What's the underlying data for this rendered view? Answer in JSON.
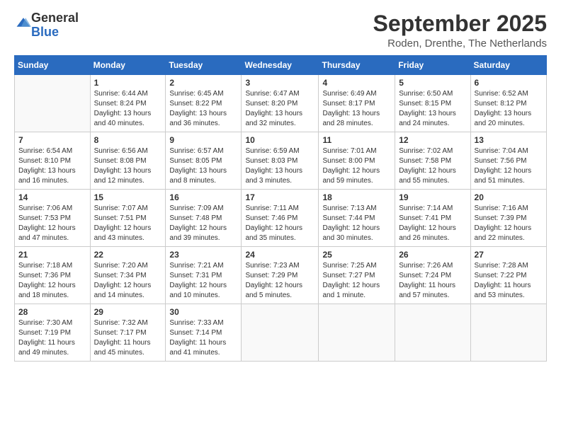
{
  "header": {
    "logo_general": "General",
    "logo_blue": "Blue",
    "month_title": "September 2025",
    "location": "Roden, Drenthe, The Netherlands"
  },
  "days_of_week": [
    "Sunday",
    "Monday",
    "Tuesday",
    "Wednesday",
    "Thursday",
    "Friday",
    "Saturday"
  ],
  "weeks": [
    [
      {
        "num": "",
        "info": ""
      },
      {
        "num": "1",
        "info": "Sunrise: 6:44 AM\nSunset: 8:24 PM\nDaylight: 13 hours\nand 40 minutes."
      },
      {
        "num": "2",
        "info": "Sunrise: 6:45 AM\nSunset: 8:22 PM\nDaylight: 13 hours\nand 36 minutes."
      },
      {
        "num": "3",
        "info": "Sunrise: 6:47 AM\nSunset: 8:20 PM\nDaylight: 13 hours\nand 32 minutes."
      },
      {
        "num": "4",
        "info": "Sunrise: 6:49 AM\nSunset: 8:17 PM\nDaylight: 13 hours\nand 28 minutes."
      },
      {
        "num": "5",
        "info": "Sunrise: 6:50 AM\nSunset: 8:15 PM\nDaylight: 13 hours\nand 24 minutes."
      },
      {
        "num": "6",
        "info": "Sunrise: 6:52 AM\nSunset: 8:12 PM\nDaylight: 13 hours\nand 20 minutes."
      }
    ],
    [
      {
        "num": "7",
        "info": "Sunrise: 6:54 AM\nSunset: 8:10 PM\nDaylight: 13 hours\nand 16 minutes."
      },
      {
        "num": "8",
        "info": "Sunrise: 6:56 AM\nSunset: 8:08 PM\nDaylight: 13 hours\nand 12 minutes."
      },
      {
        "num": "9",
        "info": "Sunrise: 6:57 AM\nSunset: 8:05 PM\nDaylight: 13 hours\nand 8 minutes."
      },
      {
        "num": "10",
        "info": "Sunrise: 6:59 AM\nSunset: 8:03 PM\nDaylight: 13 hours\nand 3 minutes."
      },
      {
        "num": "11",
        "info": "Sunrise: 7:01 AM\nSunset: 8:00 PM\nDaylight: 12 hours\nand 59 minutes."
      },
      {
        "num": "12",
        "info": "Sunrise: 7:02 AM\nSunset: 7:58 PM\nDaylight: 12 hours\nand 55 minutes."
      },
      {
        "num": "13",
        "info": "Sunrise: 7:04 AM\nSunset: 7:56 PM\nDaylight: 12 hours\nand 51 minutes."
      }
    ],
    [
      {
        "num": "14",
        "info": "Sunrise: 7:06 AM\nSunset: 7:53 PM\nDaylight: 12 hours\nand 47 minutes."
      },
      {
        "num": "15",
        "info": "Sunrise: 7:07 AM\nSunset: 7:51 PM\nDaylight: 12 hours\nand 43 minutes."
      },
      {
        "num": "16",
        "info": "Sunrise: 7:09 AM\nSunset: 7:48 PM\nDaylight: 12 hours\nand 39 minutes."
      },
      {
        "num": "17",
        "info": "Sunrise: 7:11 AM\nSunset: 7:46 PM\nDaylight: 12 hours\nand 35 minutes."
      },
      {
        "num": "18",
        "info": "Sunrise: 7:13 AM\nSunset: 7:44 PM\nDaylight: 12 hours\nand 30 minutes."
      },
      {
        "num": "19",
        "info": "Sunrise: 7:14 AM\nSunset: 7:41 PM\nDaylight: 12 hours\nand 26 minutes."
      },
      {
        "num": "20",
        "info": "Sunrise: 7:16 AM\nSunset: 7:39 PM\nDaylight: 12 hours\nand 22 minutes."
      }
    ],
    [
      {
        "num": "21",
        "info": "Sunrise: 7:18 AM\nSunset: 7:36 PM\nDaylight: 12 hours\nand 18 minutes."
      },
      {
        "num": "22",
        "info": "Sunrise: 7:20 AM\nSunset: 7:34 PM\nDaylight: 12 hours\nand 14 minutes."
      },
      {
        "num": "23",
        "info": "Sunrise: 7:21 AM\nSunset: 7:31 PM\nDaylight: 12 hours\nand 10 minutes."
      },
      {
        "num": "24",
        "info": "Sunrise: 7:23 AM\nSunset: 7:29 PM\nDaylight: 12 hours\nand 5 minutes."
      },
      {
        "num": "25",
        "info": "Sunrise: 7:25 AM\nSunset: 7:27 PM\nDaylight: 12 hours\nand 1 minute."
      },
      {
        "num": "26",
        "info": "Sunrise: 7:26 AM\nSunset: 7:24 PM\nDaylight: 11 hours\nand 57 minutes."
      },
      {
        "num": "27",
        "info": "Sunrise: 7:28 AM\nSunset: 7:22 PM\nDaylight: 11 hours\nand 53 minutes."
      }
    ],
    [
      {
        "num": "28",
        "info": "Sunrise: 7:30 AM\nSunset: 7:19 PM\nDaylight: 11 hours\nand 49 minutes."
      },
      {
        "num": "29",
        "info": "Sunrise: 7:32 AM\nSunset: 7:17 PM\nDaylight: 11 hours\nand 45 minutes."
      },
      {
        "num": "30",
        "info": "Sunrise: 7:33 AM\nSunset: 7:14 PM\nDaylight: 11 hours\nand 41 minutes."
      },
      {
        "num": "",
        "info": ""
      },
      {
        "num": "",
        "info": ""
      },
      {
        "num": "",
        "info": ""
      },
      {
        "num": "",
        "info": ""
      }
    ]
  ]
}
